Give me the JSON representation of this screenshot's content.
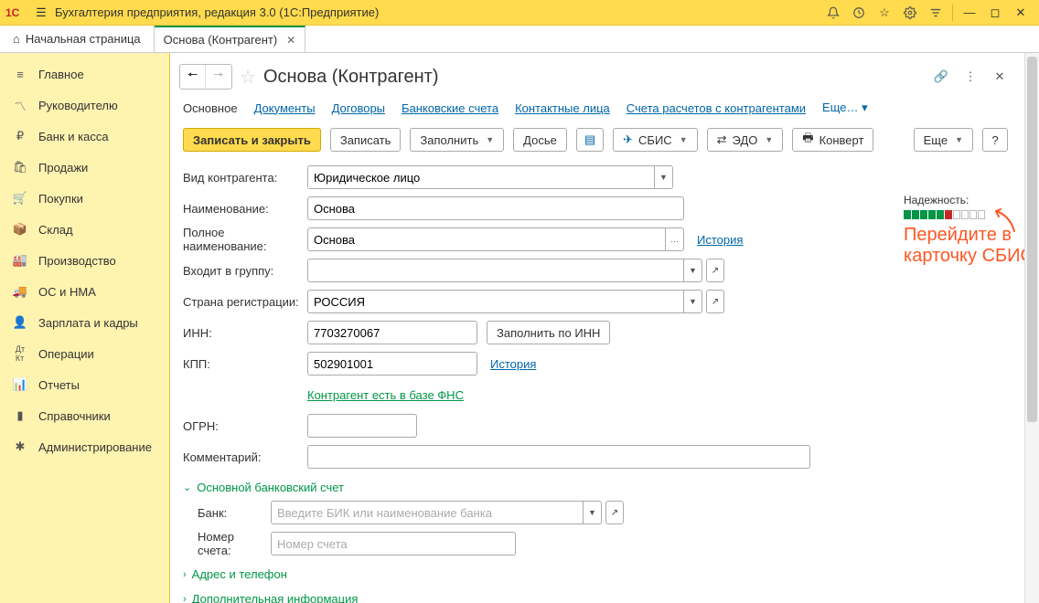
{
  "titlebar": {
    "title": "Бухгалтерия предприятия, редакция 3.0  (1С:Предприятие)"
  },
  "tabs": {
    "home": "Начальная страница",
    "doc": "Основа (Контрагент)"
  },
  "sidebar": {
    "items": [
      {
        "label": "Главное"
      },
      {
        "label": "Руководителю"
      },
      {
        "label": "Банк и касса"
      },
      {
        "label": "Продажи"
      },
      {
        "label": "Покупки"
      },
      {
        "label": "Склад"
      },
      {
        "label": "Производство"
      },
      {
        "label": "ОС и НМА"
      },
      {
        "label": "Зарплата и кадры"
      },
      {
        "label": "Операции"
      },
      {
        "label": "Отчеты"
      },
      {
        "label": "Справочники"
      },
      {
        "label": "Администрирование"
      }
    ]
  },
  "page": {
    "title_main": "Основа",
    "title_suffix": " (Контрагент)"
  },
  "sections": {
    "main": "Основное",
    "docs": "Документы",
    "contracts": "Договоры",
    "bank": "Банковские счета",
    "contacts": "Контактные лица",
    "accounts": "Счета расчетов с контрагентами",
    "more": "Еще…"
  },
  "toolbar": {
    "save_close": "Записать и закрыть",
    "save": "Записать",
    "fill": "Заполнить",
    "dossier": "Досье",
    "sbis": "СБИС",
    "edo": "ЭДО",
    "envelope": "Конверт",
    "more": "Еще",
    "help": "?"
  },
  "form": {
    "type_label": "Вид контрагента:",
    "type_value": "Юридическое лицо",
    "name_label": "Наименование:",
    "name_value": "Основа",
    "fullname_label": "Полное наименование:",
    "fullname_value": "Основа",
    "history_link": "История",
    "group_label": "Входит в группу:",
    "group_value": "",
    "country_label": "Страна регистрации:",
    "country_value": "РОССИЯ",
    "inn_label": "ИНН:",
    "inn_value": "7703270067",
    "fill_by_inn": "Заполнить по ИНН",
    "kpp_label": "КПП:",
    "kpp_value": "502901001",
    "fns_link": "Контрагент есть в базе ФНС",
    "ogrn_label": "ОГРН:",
    "ogrn_value": "",
    "comment_label": "Комментарий:",
    "comment_value": "",
    "bank_expander": "Основной банковский счет",
    "bank_label": "Банк:",
    "bank_placeholder": "Введите БИК или наименование банка",
    "account_label": "Номер счета:",
    "account_placeholder": "Номер счета",
    "address_expander": "Адрес и телефон",
    "extra_expander": "Дополнительная информация"
  },
  "reliability": {
    "label": "Надежность:"
  },
  "annotation": {
    "text": "Перейдите в карточку СБИС"
  }
}
